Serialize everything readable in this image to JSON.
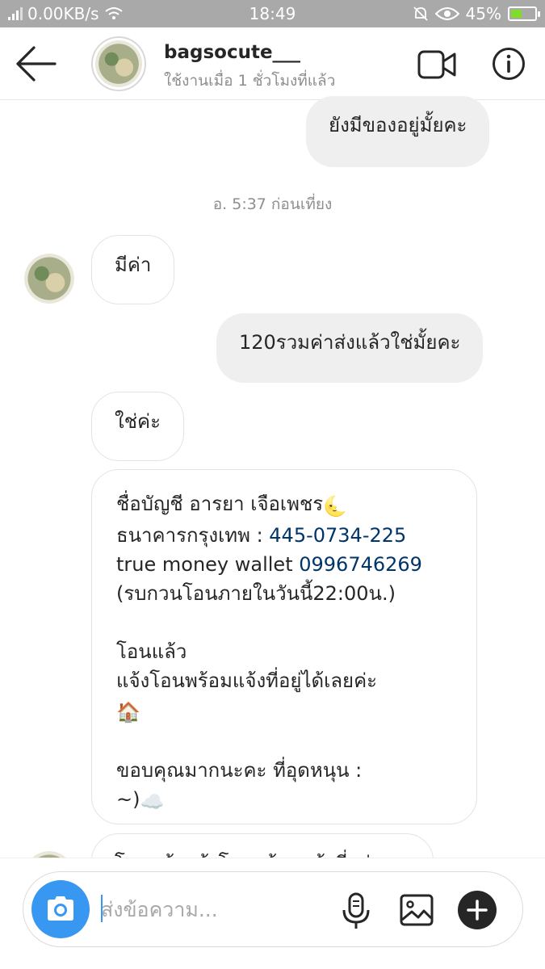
{
  "status_bar": {
    "network_speed": "0.00KB/s",
    "time": "18:49",
    "battery_percent": "45%",
    "battery_level": 0.45
  },
  "header": {
    "username": "bagsocute___",
    "last_seen": "ใช้งานเมื่อ 1 ชั่วโมงที่แล้ว",
    "icons": [
      "back-arrow-icon",
      "video-call-icon",
      "info-icon"
    ]
  },
  "messages": {
    "m1_outgoing": "ยังมีของอยู่มั้ยคะ",
    "timestamp": "อ. 5:37 ก่อนเที่ยง",
    "m2_incoming": "มีค่า",
    "m3_outgoing": "120รวมค่าส่งแล้วใช่มั้ยคะ",
    "m4_incoming": "ใช่ค่ะ",
    "m5_incoming": {
      "account_name": "ชื่อบัญชี อารยา เจือเพชร",
      "account_emoji": "🌜",
      "bank_label": "ธนาคารกรุงเทพ : ",
      "bank_number": "445-0734-225",
      "wallet_label": "true money wallet ",
      "wallet_number": "0996746269",
      "deadline": "(รบกวนโอนภายในวันนี้22:00น.)",
      "transferred": "โอนแล้ว",
      "notify": "แจ้งโอนพร้อมแจ้งที่อยู่ได้เลยค่ะ",
      "house_emoji": "🏠",
      "thanks": "ขอบคุณมากนะคะ ที่อุดหนุน :",
      "smile": "~)",
      "cloud_emoji": "☁️"
    },
    "m6_incoming_partial": "โอนแล้วแจ้งโอนพร้อมแจ้งที่อยู่"
  },
  "composer": {
    "placeholder": "ส่งข้อความ...",
    "icons": [
      "camera-icon",
      "microphone-icon",
      "gallery-icon",
      "plus-icon"
    ]
  },
  "colors": {
    "accent": "#3897f0",
    "status_bar": "#a9a9a9",
    "outgoing_bubble": "#efefef",
    "link_blue": "#003569"
  }
}
